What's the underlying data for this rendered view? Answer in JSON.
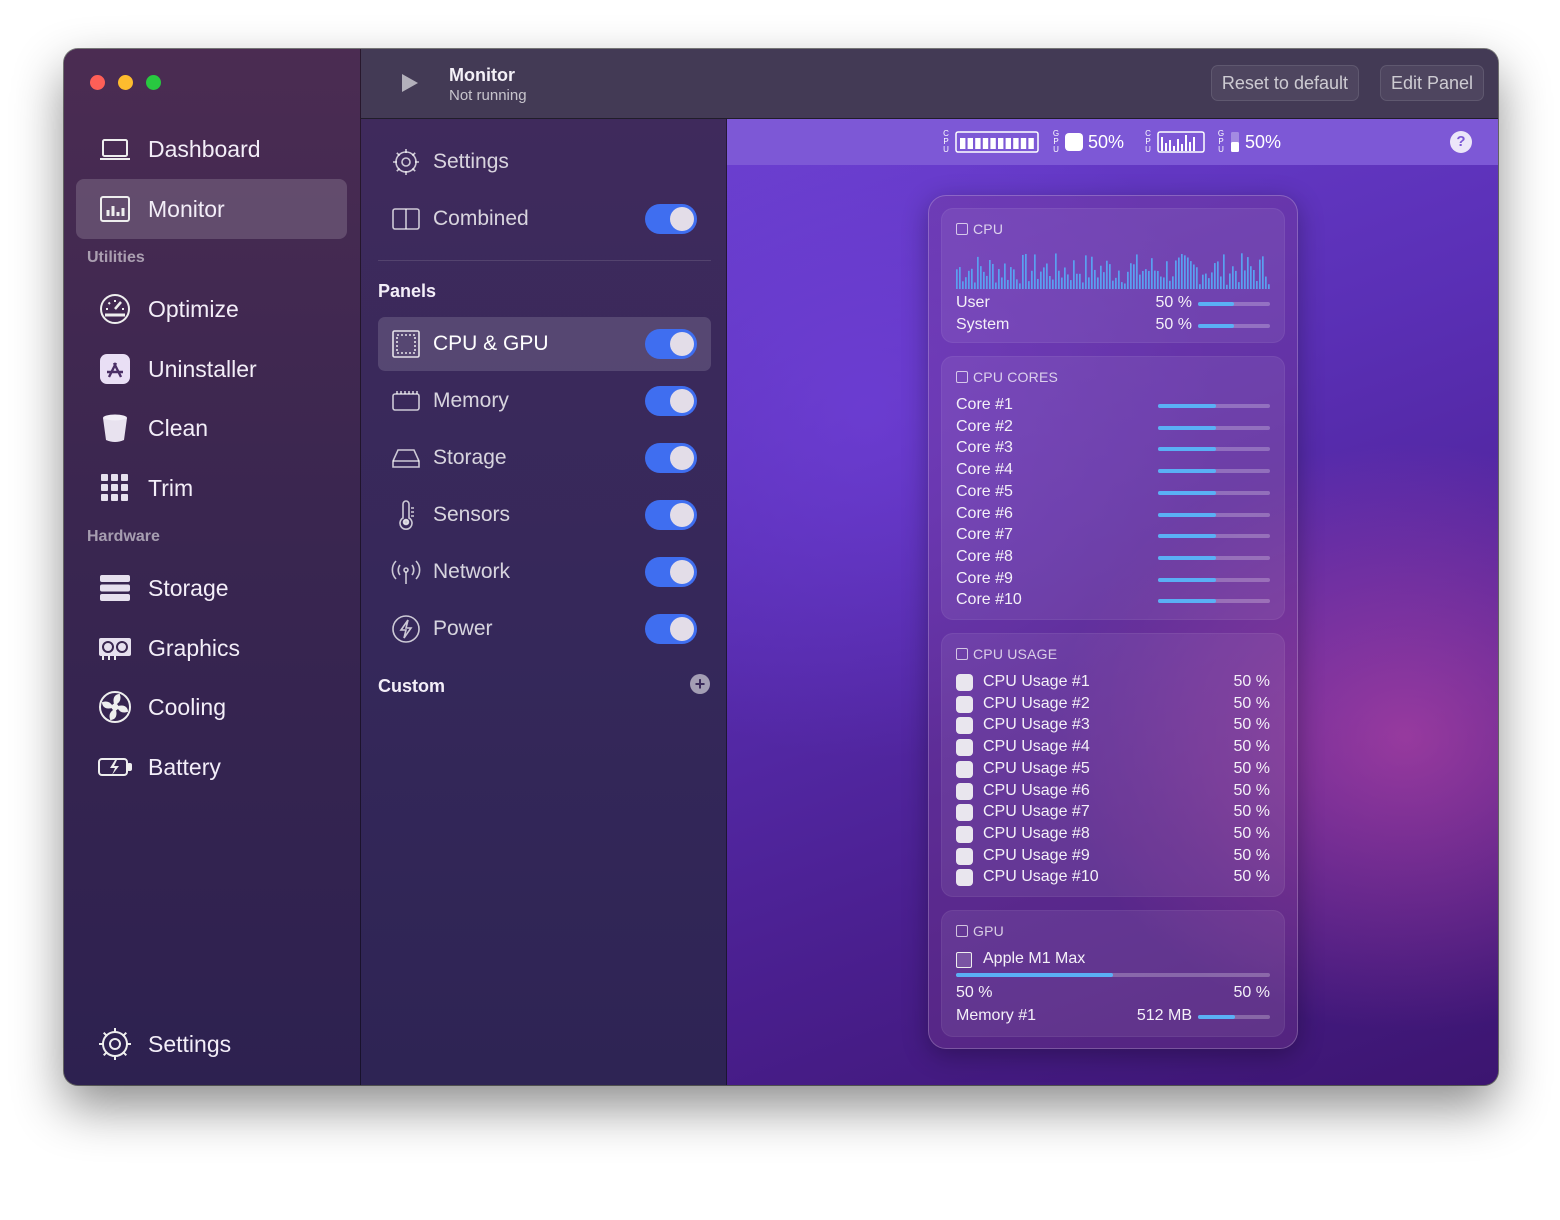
{
  "sidebar": {
    "items": [
      {
        "label": "Dashboard",
        "icon": "laptop-icon"
      },
      {
        "label": "Monitor",
        "icon": "monitor-chart-icon"
      },
      {
        "label": "Optimize",
        "icon": "gauge-icon"
      },
      {
        "label": "Uninstaller",
        "icon": "app-store-icon"
      },
      {
        "label": "Clean",
        "icon": "bucket-icon"
      },
      {
        "label": "Trim",
        "icon": "grid-icon"
      },
      {
        "label": "Storage",
        "icon": "server-icon"
      },
      {
        "label": "Graphics",
        "icon": "graphics-card-icon"
      },
      {
        "label": "Cooling",
        "icon": "fan-icon"
      },
      {
        "label": "Battery",
        "icon": "battery-icon"
      }
    ],
    "sections": {
      "utilities": "Utilities",
      "hardware": "Hardware"
    },
    "settings_label": "Settings"
  },
  "toolbar": {
    "title": "Monitor",
    "subtitle": "Not running",
    "reset_label": "Reset to default",
    "edit_label": "Edit Panel"
  },
  "mid": {
    "settings_label": "Settings",
    "combined_label": "Combined",
    "panels_heading": "Panels",
    "panels": [
      {
        "label": "CPU & GPU",
        "icon": "chip-icon",
        "enabled": true
      },
      {
        "label": "Memory",
        "icon": "memory-icon",
        "enabled": true
      },
      {
        "label": "Storage",
        "icon": "drive-icon",
        "enabled": true
      },
      {
        "label": "Sensors",
        "icon": "thermometer-icon",
        "enabled": true
      },
      {
        "label": "Network",
        "icon": "antenna-icon",
        "enabled": true
      },
      {
        "label": "Power",
        "icon": "bolt-icon",
        "enabled": true
      }
    ],
    "custom_heading": "Custom"
  },
  "statusbar": {
    "cpu_label": "CPU",
    "gpu_label": "GPU",
    "cpu_percent": "50%",
    "gpu_percent": "50%"
  },
  "popover": {
    "cpu": {
      "title": "CPU",
      "user_label": "User",
      "user_value": "50 %",
      "user_fraction": 0.5,
      "system_label": "System",
      "system_value": "50 %",
      "system_fraction": 0.5
    },
    "cores": {
      "title": "CPU CORES",
      "items": [
        "Core #1",
        "Core #2",
        "Core #3",
        "Core #4",
        "Core #5",
        "Core #6",
        "Core #7",
        "Core #8",
        "Core #9",
        "Core #10"
      ],
      "fraction": 0.52
    },
    "usage": {
      "title": "CPU USAGE",
      "items": [
        {
          "label": "CPU Usage #1",
          "value": "50 %"
        },
        {
          "label": "CPU Usage #2",
          "value": "50 %"
        },
        {
          "label": "CPU Usage #3",
          "value": "50 %"
        },
        {
          "label": "CPU Usage #4",
          "value": "50 %"
        },
        {
          "label": "CPU Usage #5",
          "value": "50 %"
        },
        {
          "label": "CPU Usage #6",
          "value": "50 %"
        },
        {
          "label": "CPU Usage #7",
          "value": "50 %"
        },
        {
          "label": "CPU Usage #8",
          "value": "50 %"
        },
        {
          "label": "CPU Usage #9",
          "value": "50 %"
        },
        {
          "label": "CPU Usage #10",
          "value": "50 %"
        }
      ]
    },
    "gpu": {
      "title": "GPU",
      "name": "Apple M1 Max",
      "fraction": 0.5,
      "util_left": "50 %",
      "util_right": "50 %",
      "memory_label": "Memory #1",
      "memory_value": "512 MB",
      "memory_fraction": 0.52
    }
  },
  "colors": {
    "accent": "#3f6ef0",
    "bar_fill": "#5ab0f5",
    "statusbar": "#7d58d6"
  }
}
